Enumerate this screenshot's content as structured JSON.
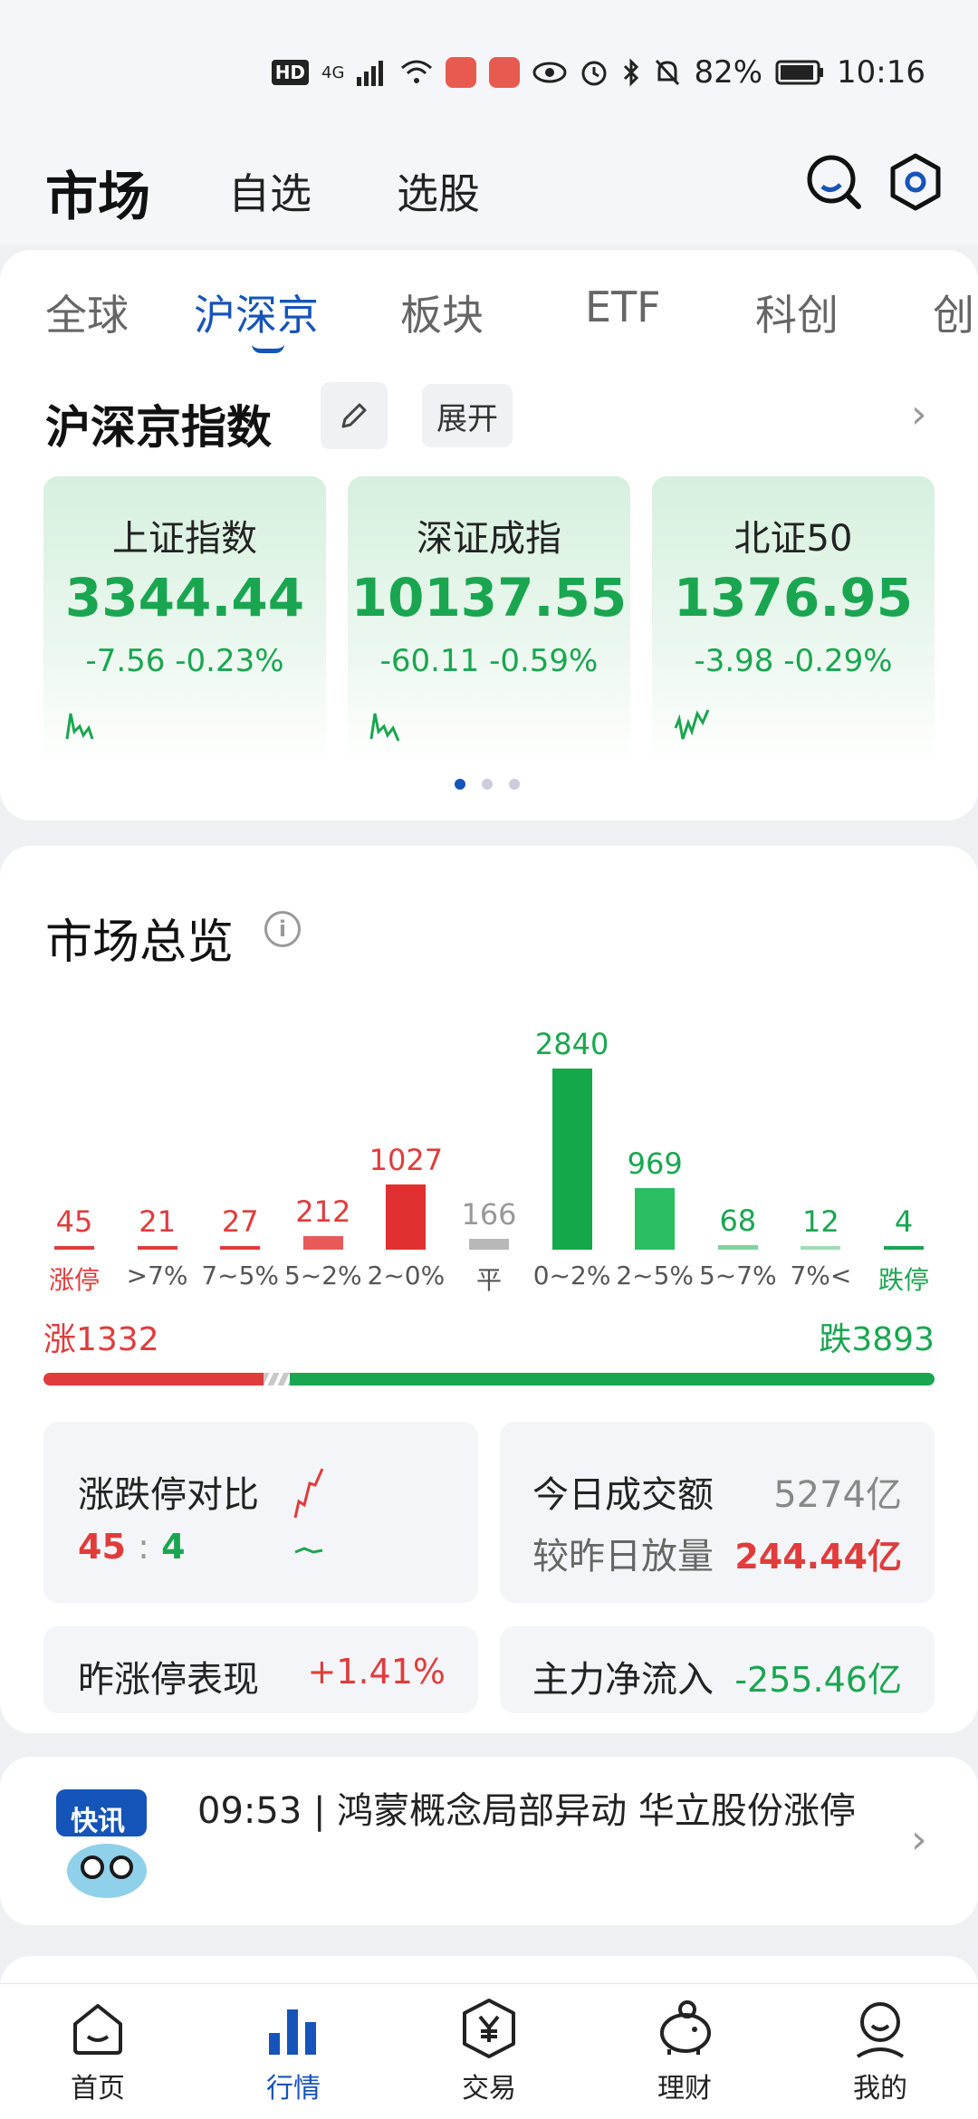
{
  "status_bar": {
    "hd": "HD",
    "network": "4G",
    "battery": "82%",
    "time": "10:16"
  },
  "header": {
    "title": "市场",
    "tabs": [
      "自选",
      "选股"
    ],
    "search_icon": "search-icon",
    "settings_icon": "hexagon-settings-icon"
  },
  "market_tabs": [
    "全球",
    "沪深京",
    "板块",
    "ETF",
    "科创",
    "创"
  ],
  "active_tab": "沪深京",
  "indices": {
    "title": "沪深京指数",
    "expand_label": "展开",
    "cards": [
      {
        "name": "上证指数",
        "value": "3344.44",
        "change": "-7.56",
        "pct": "-0.23%"
      },
      {
        "name": "深证成指",
        "value": "10137.55",
        "change": "-60.11",
        "pct": "-0.59%"
      },
      {
        "name": "北证50",
        "value": "1376.95",
        "change": "-3.98",
        "pct": "-0.29%"
      }
    ]
  },
  "overview": {
    "title": "市场总览",
    "up_label": "涨1332",
    "down_label": "跌3893",
    "limit_compare_label": "涨跌停对比",
    "limit_up": "45",
    "limit_sep": ":",
    "limit_down": "4",
    "turnover_label": "今日成交额",
    "turnover_value": "5274亿",
    "volume_change_label": "较昨日放量",
    "volume_change_value": "244.44亿",
    "prev_limit_label": "昨涨停表现",
    "prev_limit_value": "+1.41%",
    "main_flow_label": "主力净流入",
    "main_flow_value": "-255.46亿"
  },
  "chart_data": {
    "type": "bar",
    "categories": [
      "涨停",
      ">7%",
      "7~5%",
      "5~2%",
      "2~0%",
      "平",
      "0~2%",
      "2~5%",
      "5~7%",
      "7%<",
      "跌停"
    ],
    "values": [
      45,
      21,
      27,
      212,
      1027,
      166,
      2840,
      969,
      68,
      12,
      4
    ],
    "colors": [
      "#e03c3c",
      "#e03c3c",
      "#e03c3c",
      "#e85a5a",
      "#e03030",
      "#b8b8b8",
      "#14a84a",
      "#2bbd62",
      "#7fd49c",
      "#9fdcb4",
      "#1aa650"
    ],
    "up_total": 1332,
    "flat_total": 166,
    "down_total": 3893
  },
  "news": {
    "badge": "快讯",
    "text": "09:53 | 鸿蒙概念局部异动 华立股份涨停"
  },
  "bottom_nav": [
    {
      "label": "首页",
      "icon": "home-icon"
    },
    {
      "label": "行情",
      "icon": "market-chart-icon"
    },
    {
      "label": "交易",
      "icon": "yen-hexagon-icon"
    },
    {
      "label": "理财",
      "icon": "piggy-bank-icon"
    },
    {
      "label": "我的",
      "icon": "profile-icon"
    }
  ],
  "colors": {
    "accent": "#1554b8",
    "up": "#e03c3c",
    "down": "#1aa650"
  }
}
